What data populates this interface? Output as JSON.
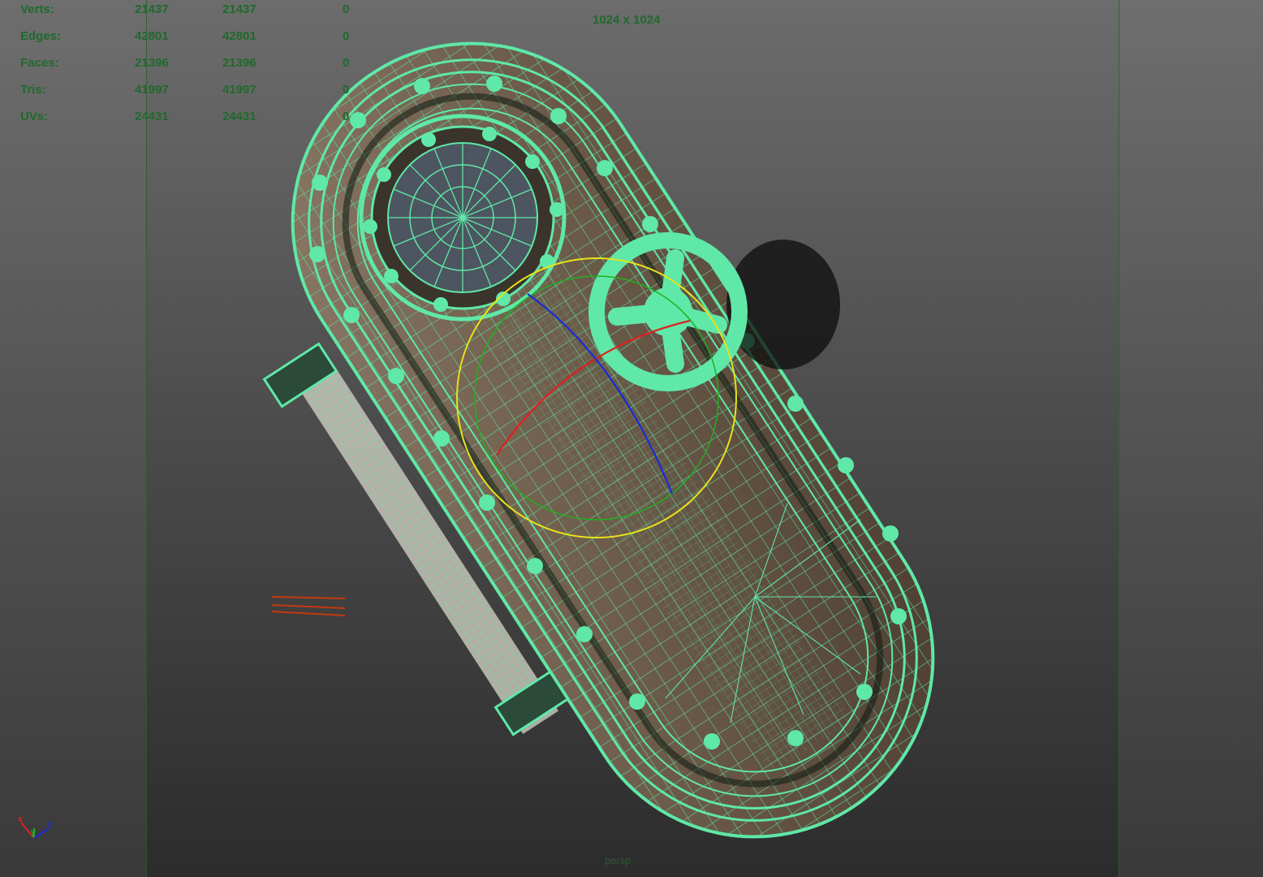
{
  "hud": {
    "rows": [
      {
        "label": "Verts:",
        "object": "21437",
        "selected": "21437",
        "count": "0"
      },
      {
        "label": "Edges:",
        "object": "42801",
        "selected": "42801",
        "count": "0"
      },
      {
        "label": "Faces:",
        "object": "21396",
        "selected": "21396",
        "count": "0"
      },
      {
        "label": "Tris:",
        "object": "41997",
        "selected": "41997",
        "count": "0"
      },
      {
        "label": "UVs:",
        "object": "24431",
        "selected": "24431",
        "count": "0"
      }
    ]
  },
  "viewport": {
    "resolution_gate": "1024 x 1024",
    "camera_label": "persp"
  },
  "axes": {
    "x": "x",
    "y": "y",
    "z": "z"
  },
  "colors": {
    "wire": "#5fe8a8",
    "hud_text": "#1f6a2c",
    "rotate_yellow": "#e8e21a",
    "axis_red": "#e02020",
    "axis_blue": "#1a2ad8",
    "axis_green": "#20b020"
  }
}
